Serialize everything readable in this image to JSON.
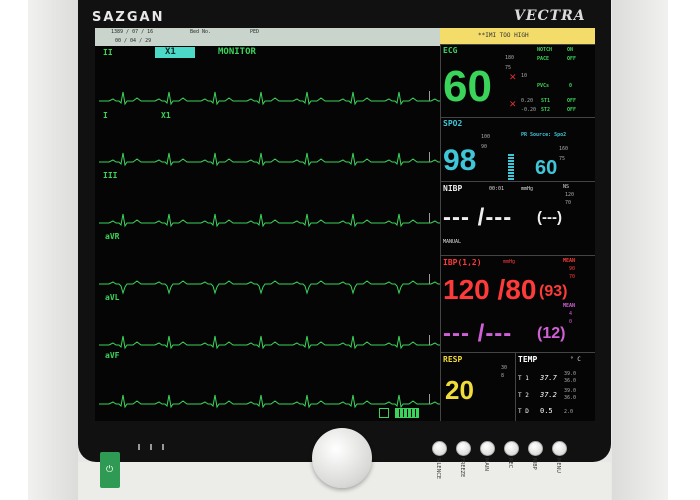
{
  "device": {
    "brand": "SAZGAN",
    "model": "VECTRA"
  },
  "topbar": {
    "date": "1389  /  07  / 16",
    "time": "00  /  04  /  29",
    "bed_label": "Bed No.",
    "patient_type": "PED"
  },
  "alarm_message": "**IMI TOO HIGH",
  "waves": {
    "mode": "X1",
    "mode_title": "MONITOR",
    "leads": [
      "II",
      "I",
      "III",
      "aVR",
      "aVL",
      "aVF"
    ],
    "lead_extra": "X1",
    "color": "#3bd45a"
  },
  "ecg": {
    "label": "ECG",
    "hr": "60",
    "hr_high": "180",
    "hr_low": "75",
    "notch_label": "NOTCH",
    "notch_value": "ON",
    "pace_label": "PACE",
    "pace_value": "OFF",
    "pvc_high": "10",
    "pvc_label": "PVCs",
    "pvc_value": "0",
    "st_high": "0.20",
    "st_low": "-0.20",
    "st1_label": "ST1",
    "st1_value": "OFF",
    "st2_label": "ST2",
    "st2_value": "OFF",
    "color": "#3bd45a"
  },
  "spo2": {
    "label": "SPO2",
    "value": "98",
    "high": "100",
    "low": "90",
    "pr_source": "PR Source: Spo2",
    "pr_value": "60",
    "pr_high": "160",
    "pr_low": "75",
    "color": "#3fc6d8"
  },
  "nibp": {
    "label": "NIBP",
    "time": "00:01",
    "unit": "mmHg",
    "ns": "NS",
    "limits": [
      "120",
      "70"
    ],
    "value": "--- /---",
    "mean": "(---)",
    "mode": "MANUAL",
    "color": "#eeeeee"
  },
  "ibp": {
    "label": "IBP(1,2)",
    "unit": "mmHg",
    "mean1_label": "MEAN",
    "mean1_limits": [
      "90",
      "70"
    ],
    "value1": "120 /80",
    "mean1": "(93)",
    "mean2_label": "MEAN",
    "mean2_limits": [
      "4",
      "0"
    ],
    "value2": "--- /---",
    "mean2": "(12)",
    "color1": "#ff3a3a",
    "color2": "#d060d8"
  },
  "resp": {
    "label": "RESP",
    "value": "20",
    "high": "30",
    "low": "8",
    "color": "#f2dc3a"
  },
  "temp": {
    "label": "TEMP",
    "unit": "° C",
    "rows": [
      {
        "name": "T 1",
        "value": "37.7",
        "high": "39.0",
        "low": "36.0"
      },
      {
        "name": "T 2",
        "value": "37.2",
        "high": "39.0",
        "low": "36.0"
      },
      {
        "name": "T D",
        "value": "0.5",
        "high": "2.0",
        "low": ""
      }
    ],
    "color": "#ffffff"
  },
  "keys": [
    "SILENCE",
    "FREEZE",
    "MAIN",
    "REC",
    "NIBP",
    "MENU"
  ],
  "power_symbol": "⏻"
}
